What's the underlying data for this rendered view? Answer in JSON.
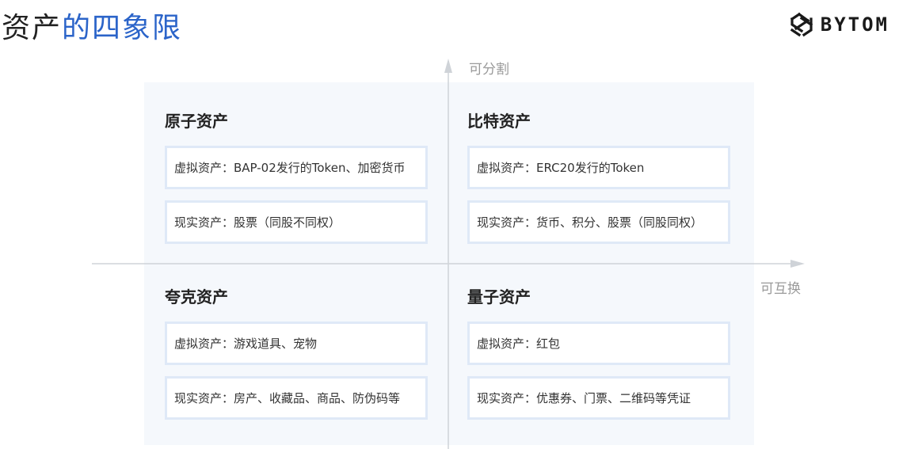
{
  "header": {
    "title_main": "资产",
    "title_accent": "的四象限",
    "logo_text": "BYTOM"
  },
  "axes": {
    "vertical_label": "可分割",
    "horizontal_label": "可互换"
  },
  "quadrants": [
    {
      "title": "原子资产",
      "items": [
        "虚拟资产：BAP-02发行的Token、加密货币",
        "现实资产：股票（同股不同权）"
      ]
    },
    {
      "title": "比特资产",
      "items": [
        "虚拟资产：ERC20发行的Token",
        "现实资产：货币、积分、股票（同股同权）"
      ]
    },
    {
      "title": "夸克资产",
      "items": [
        "虚拟资产：游戏道具、宠物",
        "现实资产：房产、收藏品、商品、防伪码等"
      ]
    },
    {
      "title": "量子资产",
      "items": [
        "虚拟资产：红包",
        "现实资产：优惠券、门票、二维码等凭证"
      ]
    }
  ],
  "colors": {
    "accent": "#2b64c9",
    "panel_bg": "#f5f8fc",
    "card_border": "#dfe9f7",
    "axis": "#cfd3d8"
  }
}
